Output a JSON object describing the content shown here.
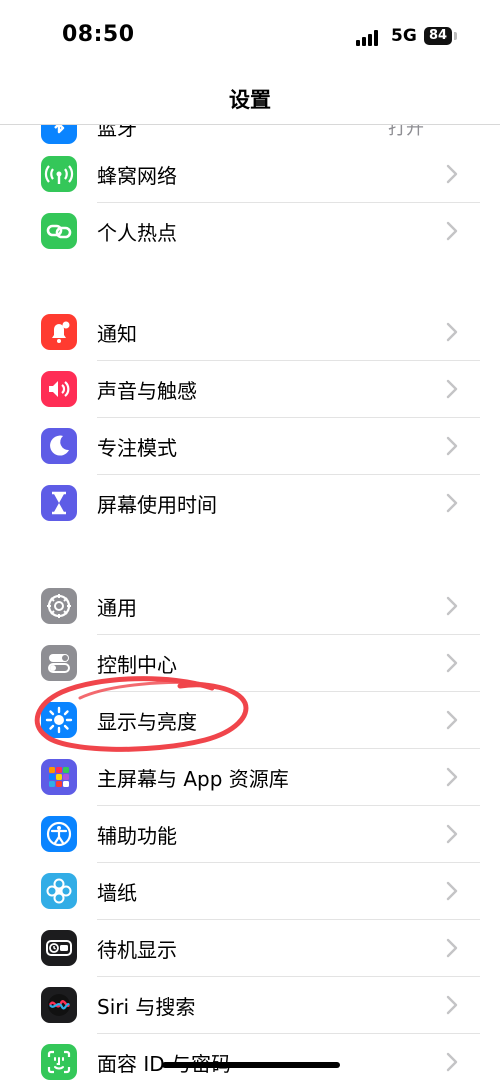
{
  "status_bar": {
    "time": "08:50",
    "network": "5G",
    "battery": "84"
  },
  "nav": {
    "title": "设置"
  },
  "partial_item": {
    "label": "蓝牙",
    "value": "打开",
    "icon": "bluetooth-icon",
    "color": "#0A84FF"
  },
  "groups": [
    {
      "items": [
        {
          "label": "蜂窝网络",
          "icon": "antenna-icon",
          "color": "#34C759"
        },
        {
          "label": "个人热点",
          "icon": "link-icon",
          "color": "#34C759"
        }
      ]
    },
    {
      "items": [
        {
          "label": "通知",
          "icon": "bell-icon",
          "color": "#FF3B30"
        },
        {
          "label": "声音与触感",
          "icon": "speaker-icon",
          "color": "#FF2D55"
        },
        {
          "label": "专注模式",
          "icon": "moon-icon",
          "color": "#5E5CE6"
        },
        {
          "label": "屏幕使用时间",
          "icon": "hourglass-icon",
          "color": "#5E5CE6"
        }
      ]
    },
    {
      "items": [
        {
          "label": "通用",
          "icon": "gear-icon",
          "color": "#8E8E93"
        },
        {
          "label": "控制中心",
          "icon": "toggles-icon",
          "color": "#8E8E93"
        },
        {
          "label": "显示与亮度",
          "icon": "sun-icon",
          "color": "#0A84FF"
        },
        {
          "label": "主屏幕与 App 资源库",
          "icon": "app-grid-icon",
          "color": "#5E5CE6"
        },
        {
          "label": "辅助功能",
          "icon": "accessibility-icon",
          "color": "#0A84FF"
        },
        {
          "label": "墙纸",
          "icon": "flower-icon",
          "color": "#32ADE6"
        },
        {
          "label": "待机显示",
          "icon": "standby-icon",
          "color": "#1C1C1E"
        },
        {
          "label": "Siri 与搜索",
          "icon": "siri-icon",
          "color": "#1C1C1E"
        },
        {
          "label": "面容 ID 与密码",
          "icon": "face-id-icon",
          "color": "#34C759"
        }
      ]
    }
  ],
  "annotation": {
    "shape": "hand-drawn circle",
    "color": "#F0454B",
    "target": "显示与亮度"
  }
}
